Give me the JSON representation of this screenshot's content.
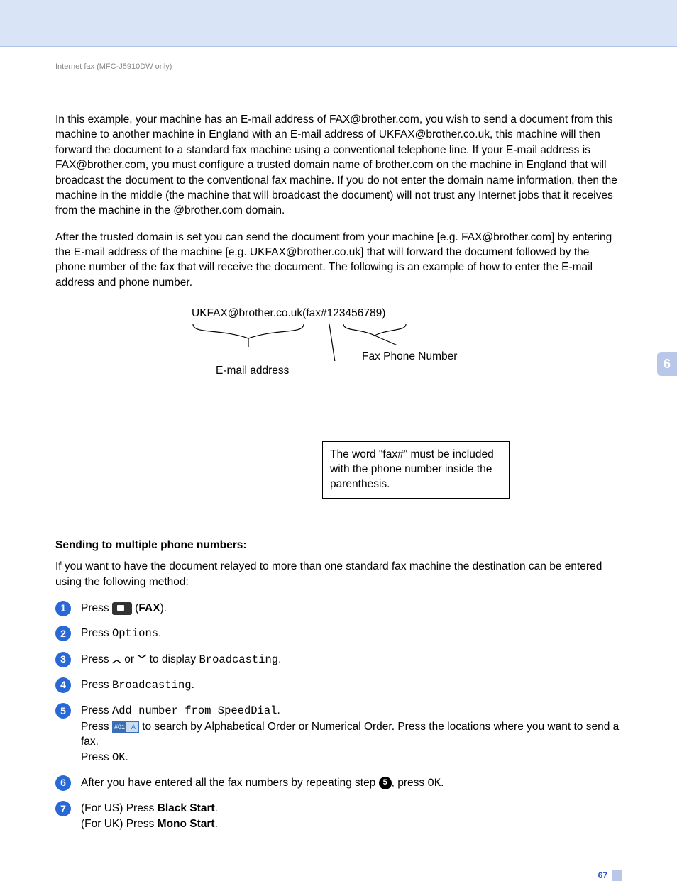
{
  "breadcrumb": "Internet fax (MFC-J5910DW only)",
  "chapter_tab": "6",
  "para1": "In this example, your machine has an E-mail address of FAX@brother.com, you wish to send a document from this machine to another machine in England with an E-mail address of UKFAX@brother.co.uk, this machine will then forward the document to a standard fax machine using a conventional telephone line. If your E-mail address is FAX@brother.com, you must configure a trusted domain name of brother.com on the machine in England that will broadcast the document to the conventional fax machine. If you do not enter the domain name information, then the machine in the middle (the machine that will broadcast the document) will not trust any Internet jobs that it receives from the machine in the @brother.com domain.",
  "para2": "After the trusted domain is set you can send the document from your machine [e.g. FAX@brother.com] by entering the E-mail address of the machine [e.g. UKFAX@brother.co.uk] that will forward the document followed by the phone number of the fax that will receive the document. The following is an example of how to enter the E-mail address and phone number.",
  "diagram": {
    "address_line": "UKFAX@brother.co.uk(fax#123456789)",
    "email_label": "E-mail address",
    "fax_label": "Fax Phone Number",
    "note": "The word \"fax#\" must be included with the phone number inside the parenthesis."
  },
  "subhead": "Sending to multiple phone numbers:",
  "intro_para": "If you want to have the document relayed to more than one standard fax machine the destination can be entered using the following method:",
  "steps": {
    "s1_press": "Press ",
    "s1_fax": "FAX",
    "s2_press": "Press ",
    "s2_options": "Options",
    "s3_a": "Press ",
    "s3_b": " or ",
    "s3_c": " to display ",
    "s3_broadcasting": "Broadcasting",
    "s4_press": "Press ",
    "s4_broadcasting": "Broadcasting",
    "s5_press": "Press ",
    "s5_add": "Add number from SpeedDial",
    "s5_line2a": "Press ",
    "s5_line2b": " to search by Alphabetical Order or Numerical Order. Press the locations where you want to send a fax.",
    "s5_line3a": "Press ",
    "s5_ok": "OK",
    "s6_a": "After you have entered all the fax numbers by repeating step ",
    "s6_ref": "5",
    "s6_b": ", press ",
    "s6_ok": "OK",
    "s7_us_a": "(For US) Press ",
    "s7_us_b": "Black Start",
    "s7_uk_a": "(For UK) Press ",
    "s7_uk_b": "Mono Start"
  },
  "page_number": "67"
}
